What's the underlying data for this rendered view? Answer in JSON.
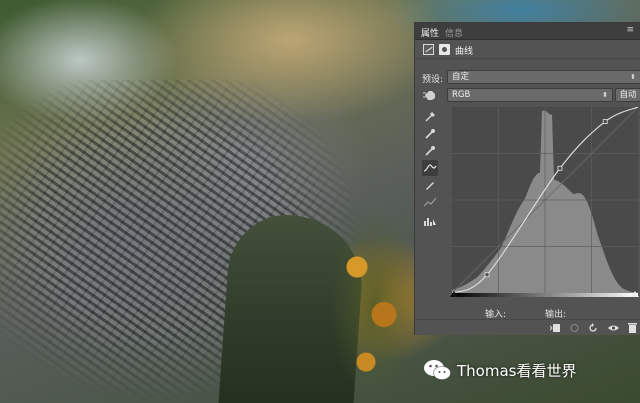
{
  "panel": {
    "tabs": [
      {
        "label": "属性",
        "active": true
      },
      {
        "label": "信息",
        "active": false
      }
    ],
    "menu_glyph": "≡",
    "title": "曲线",
    "preset": {
      "label": "预设:",
      "value": "自定"
    },
    "channel": {
      "value": "RGB",
      "auto_label": "自动"
    },
    "tools": [
      "on-image-adjust-icon",
      "black-point-eyedropper-icon",
      "gray-point-eyedropper-icon",
      "white-point-eyedropper-icon",
      "curve-point-tool-icon",
      "pencil-tool-icon",
      "smooth-icon",
      "histogram-warning-icon"
    ],
    "input_label": "输入:",
    "output_label": "输出:",
    "bottom_icons": [
      "clip-to-layer-icon",
      "view-previous-icon",
      "reset-icon",
      "visibility-eye-icon",
      "delete-icon"
    ]
  },
  "curve": {
    "input_max": 255,
    "points": [
      [
        0,
        0
      ],
      [
        48,
        25
      ],
      [
        148,
        171
      ],
      [
        210,
        235
      ],
      [
        255,
        255
      ]
    ]
  },
  "watermark": {
    "text": "Thomas看看世界"
  },
  "colors": {
    "panel_bg": "#535353",
    "graph_bg": "#4a4a4a",
    "histogram": "#8a8a8a",
    "curve": "#d8d8d8"
  }
}
